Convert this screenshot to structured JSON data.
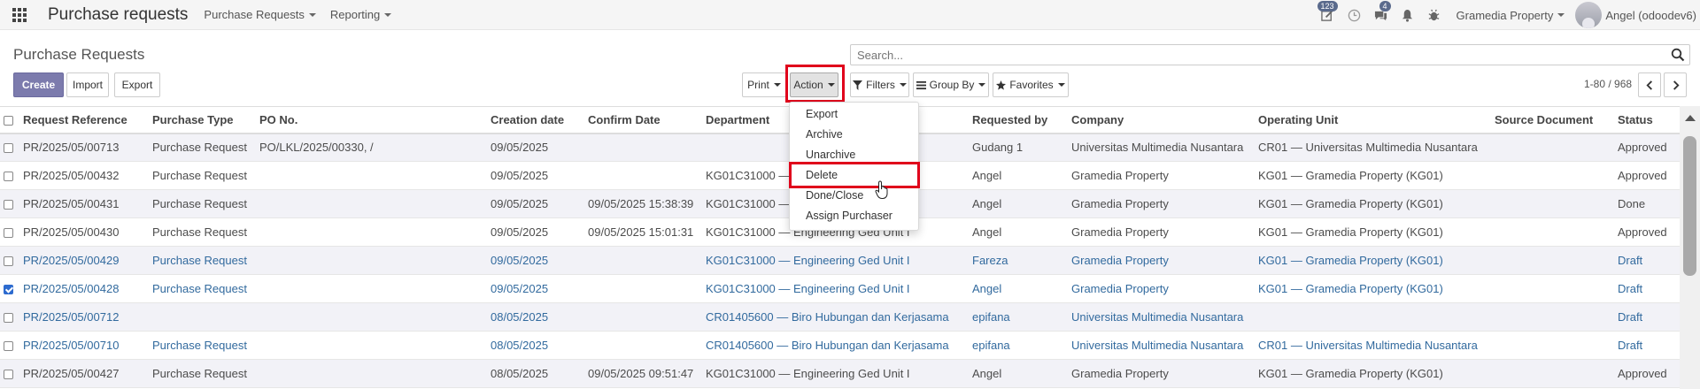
{
  "navbar": {
    "app_title": "Purchase requests",
    "menus": [
      "Purchase Requests",
      "Reporting"
    ],
    "activity_badge": "123",
    "messages_badge": "4",
    "company": "Gramedia Property",
    "user": "Angel (odoodev6)"
  },
  "control_panel": {
    "breadcrumb": "Purchase Requests",
    "search_placeholder": "Search...",
    "create": "Create",
    "import": "Import",
    "export": "Export",
    "print": "Print",
    "action": "Action",
    "filters": "Filters",
    "group_by": "Group By",
    "favorites": "Favorites",
    "pager": "1-80 / 968"
  },
  "table": {
    "headers": [
      "Request Reference",
      "Purchase Type",
      "PO No.",
      "Creation date",
      "Confirm Date",
      "Department",
      "Requested by",
      "Company",
      "Operating Unit",
      "Source Document",
      "Status"
    ],
    "rows": [
      {
        "ref": "PR/2025/05/00713",
        "type": "Purchase Request",
        "po": "PO/LKL/2025/00330, /",
        "created": "09/05/2025",
        "confirm": "",
        "dept": "",
        "requester": "Gudang 1",
        "company": "Universitas Multimedia Nusantara",
        "ou": "CR01 — Universitas Multimedia Nusantara",
        "source": "",
        "status": "Approved"
      },
      {
        "ref": "PR/2025/05/00432",
        "type": "Purchase Request",
        "po": "",
        "created": "09/05/2025",
        "confirm": "",
        "dept": "KG01C31000 —",
        "requester": "Angel",
        "company": "Gramedia Property",
        "ou": "KG01 — Gramedia Property (KG01)",
        "source": "",
        "status": "Approved"
      },
      {
        "ref": "PR/2025/05/00431",
        "type": "Purchase Request",
        "po": "",
        "created": "09/05/2025",
        "confirm": "09/05/2025 15:38:39",
        "dept": "KG01C31000 —",
        "requester": "Angel",
        "company": "Gramedia Property",
        "ou": "KG01 — Gramedia Property (KG01)",
        "source": "",
        "status": "Done"
      },
      {
        "ref": "PR/2025/05/00430",
        "type": "Purchase Request",
        "po": "",
        "created": "09/05/2025",
        "confirm": "09/05/2025 15:01:31",
        "dept": "KG01C31000 — Engineering Ged Unit I",
        "requester": "Angel",
        "company": "Gramedia Property",
        "ou": "KG01 — Gramedia Property (KG01)",
        "source": "",
        "status": "Approved"
      },
      {
        "ref": "PR/2025/05/00429",
        "type": "Purchase Request",
        "po": "",
        "created": "09/05/2025",
        "confirm": "",
        "dept": "KG01C31000 — Engineering Ged Unit I",
        "requester": "Fareza",
        "company": "Gramedia Property",
        "ou": "KG01 — Gramedia Property (KG01)",
        "source": "",
        "status": "Draft"
      },
      {
        "ref": "PR/2025/05/00428",
        "type": "Purchase Request",
        "po": "",
        "created": "09/05/2025",
        "confirm": "",
        "dept": "KG01C31000 — Engineering Ged Unit I",
        "requester": "Angel",
        "company": "Gramedia Property",
        "ou": "KG01 — Gramedia Property (KG01)",
        "source": "",
        "status": "Draft"
      },
      {
        "ref": "PR/2025/05/00712",
        "type": "",
        "po": "",
        "created": "08/05/2025",
        "confirm": "",
        "dept": "CR01405600 — Biro Hubungan dan Kerjasama",
        "requester": "epifana",
        "company": "Universitas Multimedia Nusantara",
        "ou": "",
        "source": "",
        "status": "Draft"
      },
      {
        "ref": "PR/2025/05/00710",
        "type": "Purchase Request",
        "po": "",
        "created": "08/05/2025",
        "confirm": "",
        "dept": "CR01405600 — Biro Hubungan dan Kerjasama",
        "requester": "epifana",
        "company": "Universitas Multimedia Nusantara",
        "ou": "CR01 — Universitas Multimedia Nusantara",
        "source": "",
        "status": "Draft"
      },
      {
        "ref": "PR/2025/05/00427",
        "type": "Purchase Request",
        "po": "",
        "created": "08/05/2025",
        "confirm": "09/05/2025 09:51:47",
        "dept": "KG01C31000 — Engineering Ged Unit I",
        "requester": "Angel",
        "company": "Gramedia Property",
        "ou": "KG01 — Gramedia Property (KG01)",
        "source": "",
        "status": "Approved"
      }
    ]
  },
  "action_menu": [
    "Export",
    "Archive",
    "Unarchive",
    "Delete",
    "Done/Close",
    "Assign Purchaser"
  ],
  "colors": {
    "primary": "#7c7bad",
    "draft_text": "#326a9e",
    "highlight": "#e0001b"
  }
}
